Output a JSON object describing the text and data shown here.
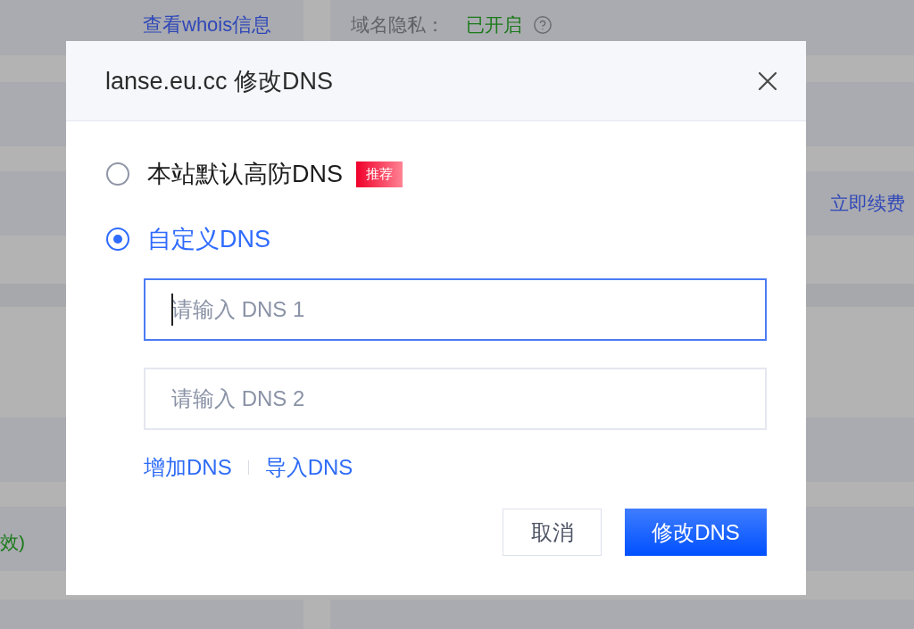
{
  "background_page": {
    "whois_link": "查看whois信息",
    "privacy_label": "域名隐私：",
    "privacy_status": "已开启",
    "renew_link": "立即续费",
    "cut_text": "效)"
  },
  "dialog": {
    "title": "lanse.eu.cc 修改DNS",
    "options": [
      {
        "label": "本站默认高防DNS",
        "tag": "推荐",
        "selected": false
      },
      {
        "label": "自定义DNS",
        "selected": true
      }
    ],
    "dns_fields": [
      {
        "placeholder": "请输入 DNS 1",
        "focused": true
      },
      {
        "placeholder": "请输入 DNS 2",
        "focused": false
      }
    ],
    "links": [
      "增加DNS",
      "导入DNS"
    ],
    "buttons": [
      {
        "label": "取消",
        "kind": "secondary"
      },
      {
        "label": "修改DNS",
        "kind": "primary"
      }
    ]
  }
}
